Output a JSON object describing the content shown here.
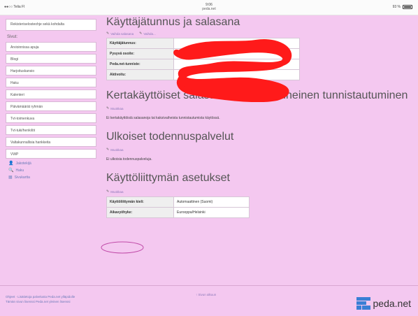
{
  "status": {
    "carrier": "●●○○ Telia FI",
    "time": "9:06",
    "url": "peda.net",
    "battery": "93 %"
  },
  "sidebar": {
    "notice": "Rekisteriselosteohje sekä kohdalta",
    "pages_heading": "Sivut:",
    "items": [
      {
        "label": "Arvioinnissa apuja"
      },
      {
        "label": "Blogi"
      },
      {
        "label": "Harjoituskansio"
      },
      {
        "label": "Haku"
      },
      {
        "label": "Kalenteri"
      },
      {
        "label": "Päivämäärät ryhmän"
      },
      {
        "label": "Tvt-toimenkuva"
      },
      {
        "label": "Tvt-tuki/henkilöt"
      },
      {
        "label": "Valtakunnallisia hankkeita"
      },
      {
        "label": "VWP"
      }
    ],
    "links": [
      {
        "icon": "user-icon",
        "label": "Jakotekijä"
      },
      {
        "icon": "search-icon",
        "label": "Haku"
      },
      {
        "icon": "grid-icon",
        "label": "Sivukartta"
      }
    ]
  },
  "main": {
    "section1": {
      "title": "Käyttäjätunnus ja salasana",
      "edit_links": [
        "Vaihda salasana",
        "Vaihda..."
      ],
      "rows": [
        {
          "key": "Käyttäjätunnus:",
          "value": ""
        },
        {
          "key": "Pysyvä osoite:",
          "value": ""
        },
        {
          "key": "Peda.net-tunniste:",
          "value": ""
        },
        {
          "key": "Aktivoitu:",
          "value": ""
        }
      ]
    },
    "section2": {
      "title": "Kertakäyttöiset salasanat ja kaksivaiheinen tunnistautuminen",
      "edit": "Muokkaa",
      "text": "Ei kertakäyttöisiä salasanoja tai kaksivaiheista tunnistautumista käytössä."
    },
    "section3": {
      "title": "Ulkoiset todennuspalvelut",
      "edit": "Muokkaa",
      "text": "Ei ulkoisia todennuspalveluja."
    },
    "section4": {
      "title": "Käyttöliittymän asetukset",
      "edit": "Muokkaa",
      "rows": [
        {
          "key": "Käyttöliittymän kieli:",
          "value": "Automaattinen (Suomi)"
        },
        {
          "key": "Aikavyöhyke:",
          "value": "Eurooppa/Helsinki"
        }
      ]
    }
  },
  "footer": {
    "line1": "Ohjeet · Lisätietoja palvelusta Peda.net ylläpidolle",
    "line2": "Tämän sivun lisenssi Peda.net yleinen lisenssi",
    "top_link": "↑ Sivun alkuun",
    "brand": "peda.net"
  },
  "colors": {
    "page_background": "#f4c8f0",
    "scribble": "#ff1a1a",
    "link": "#6a7ab8"
  }
}
